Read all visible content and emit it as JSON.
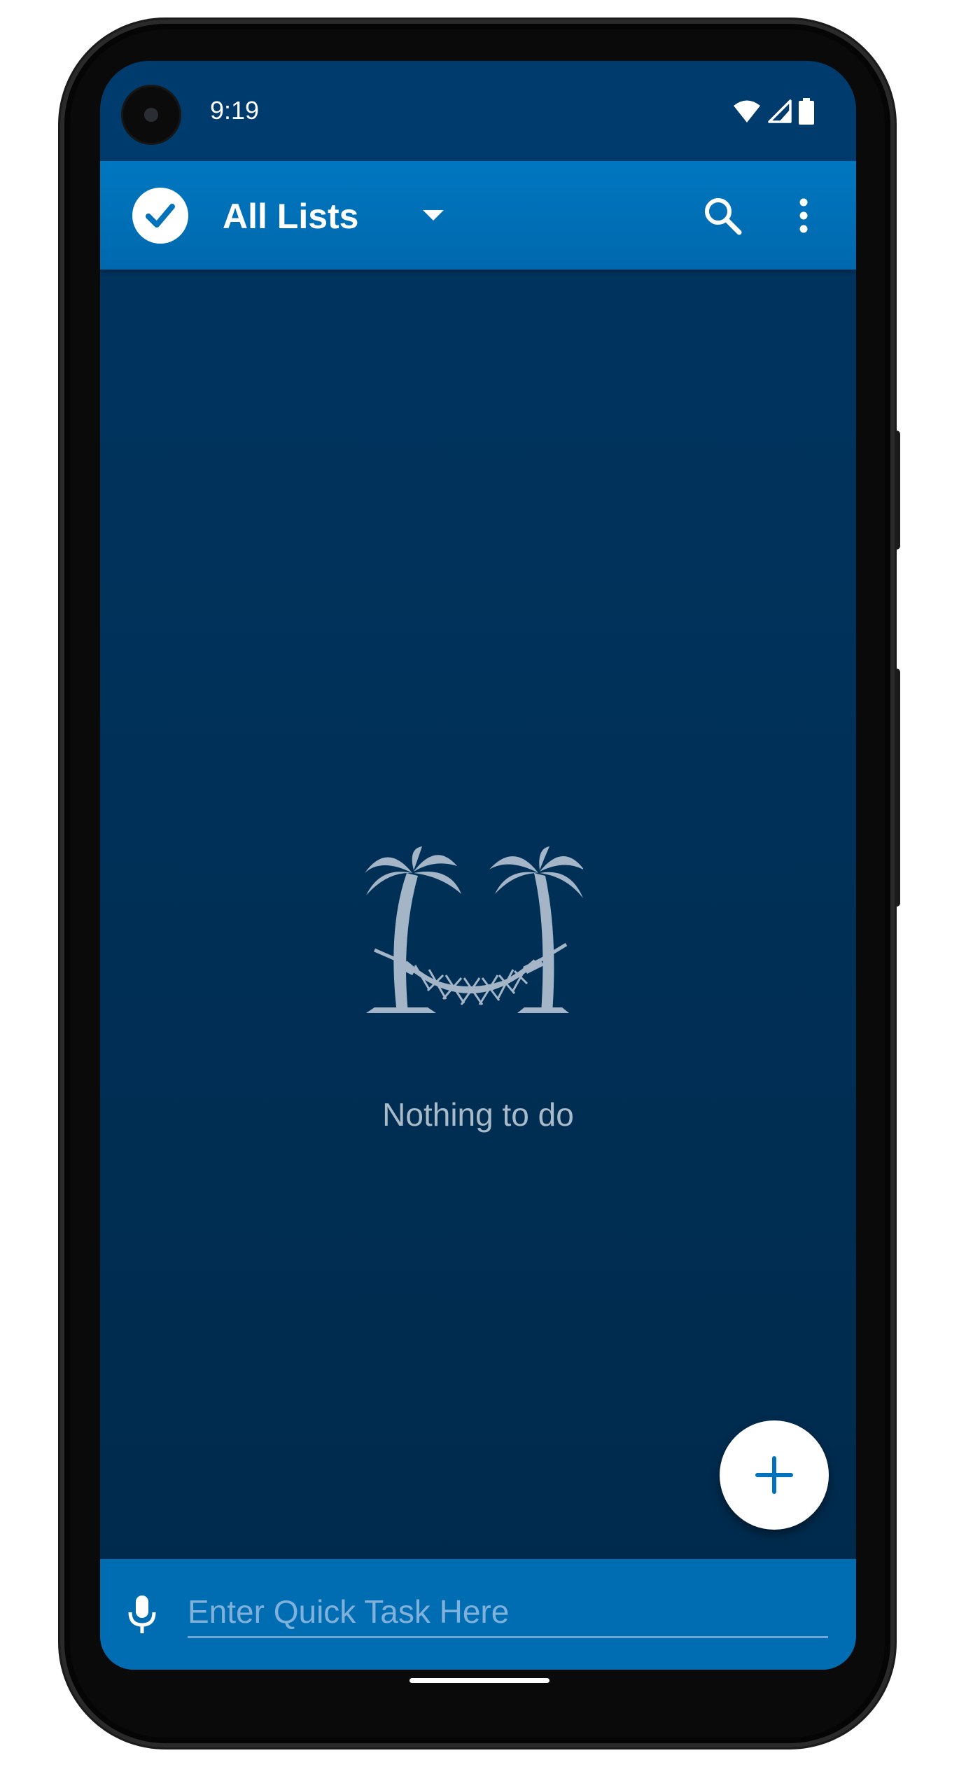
{
  "status_bar": {
    "time": "9:19",
    "icons": [
      "wifi-icon",
      "cell-signal-icon",
      "battery-icon"
    ]
  },
  "app_bar": {
    "title": "All Lists",
    "logo_icon": "check-circle-icon",
    "actions": [
      "dropdown-arrow-icon",
      "search-icon",
      "more-vert-icon"
    ]
  },
  "empty_state": {
    "illustration": "palm-trees-hammock-icon",
    "message": "Nothing to do"
  },
  "fab": {
    "icon": "plus-icon"
  },
  "quick_task": {
    "mic_icon": "microphone-icon",
    "placeholder": "Enter Quick Task Here",
    "value": ""
  },
  "colors": {
    "app_bar": "#0077c0",
    "status_bar": "#003b6e",
    "background": "#00305a",
    "quick_bar": "#006db3",
    "accent": "#0072bc",
    "empty_text": "#a9bac9"
  }
}
